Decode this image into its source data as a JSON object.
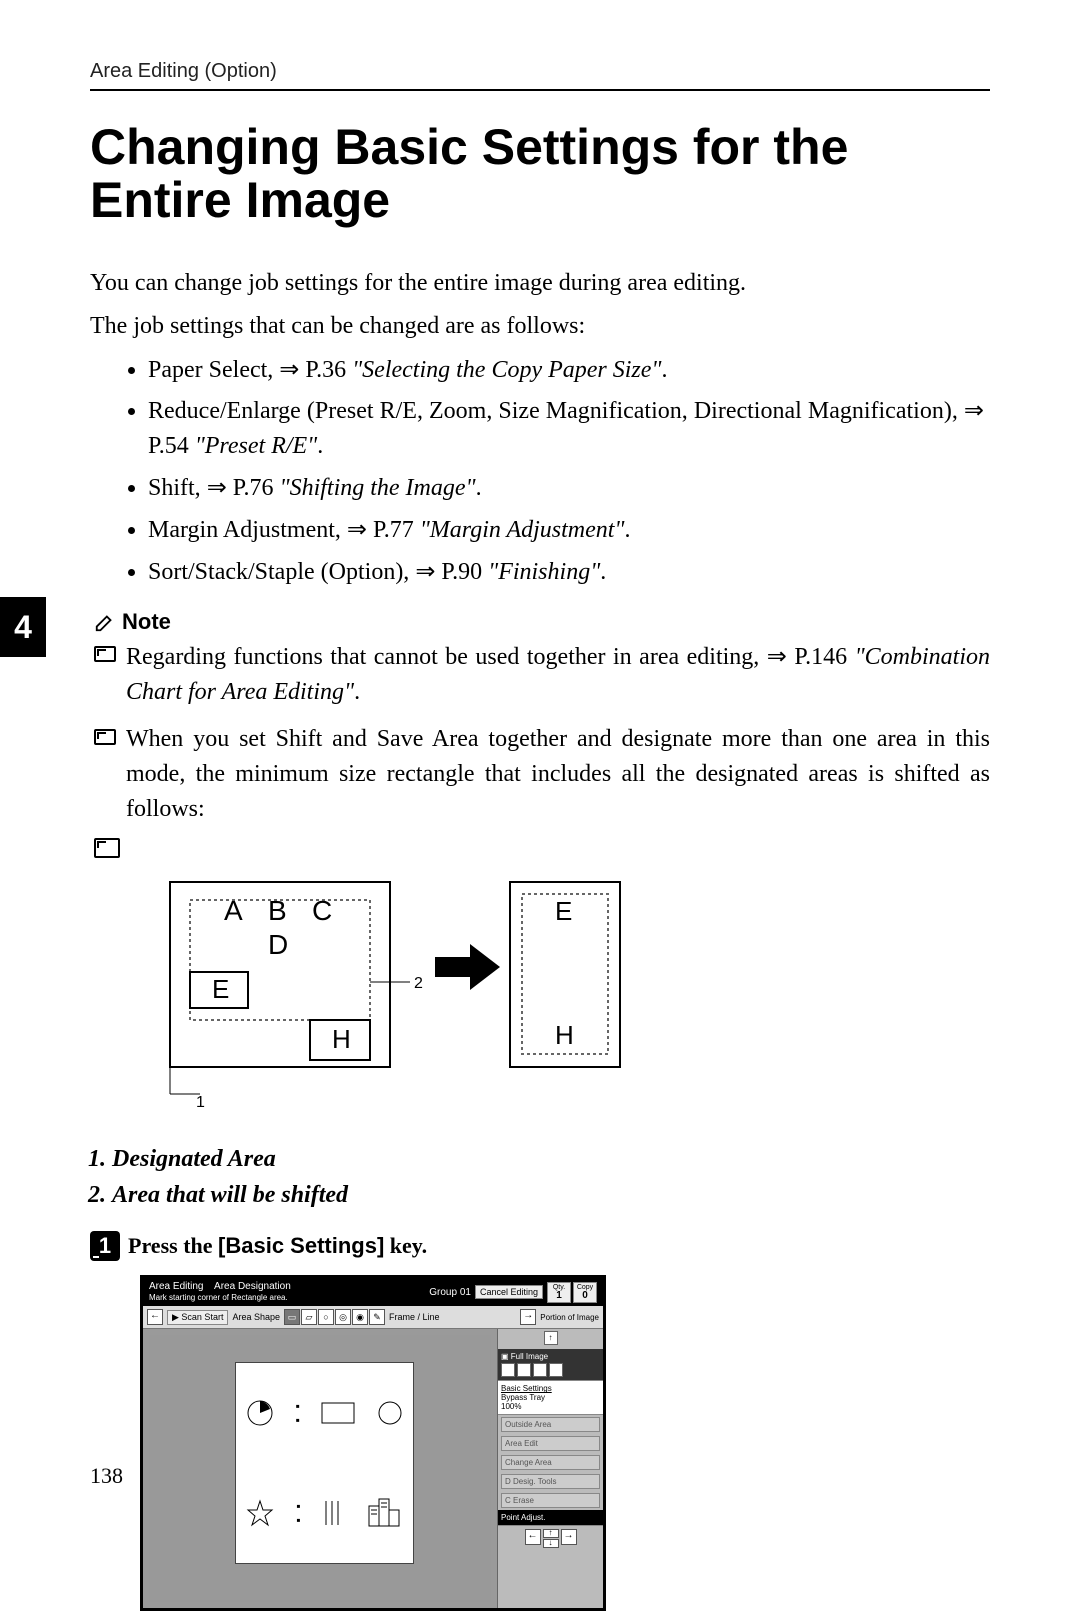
{
  "runningHead": "Area Editing (Option)",
  "title": "Changing Basic Settings for the Entire Image",
  "intro1": "You can change job settings for the entire image during area editing.",
  "intro2": "The job settings that can be changed are as follows:",
  "bullets": {
    "b1a": "Paper Select, ",
    "b1b": " P.36 ",
    "b1c": "\"Selecting the Copy Paper Size\"",
    "b1d": ".",
    "b2a": "Reduce/Enlarge (Preset R/E, Zoom, Size Magnification, Directional Magnification), ",
    "b2b": " P.54 ",
    "b2c": "\"Preset R/E\"",
    "b2d": ".",
    "b3a": "Shift, ",
    "b3b": " P.76 ",
    "b3c": "\"Shifting the Image\"",
    "b3d": ".",
    "b4a": "Margin Adjustment, ",
    "b4b": " P.77 ",
    "b4c": "\"Margin Adjustment\"",
    "b4d": ".",
    "b5a": "Sort/Stack/Staple (Option), ",
    "b5b": " P.90 ",
    "b5c": "\"Finishing\"",
    "b5d": "."
  },
  "sideTab": "4",
  "noteHead": "Note",
  "notes": {
    "n1a": "Regarding functions that cannot be used together in area editing, ",
    "n1b": " P.146 ",
    "n1c": "\"Combination Chart for Area Editing\"",
    "n1d": ".",
    "n2": "When you set Shift and Save Area together and designate more than one area in this mode, the minimum size rectangle that includes all the designated areas is shifted as follows:"
  },
  "diag": {
    "A": "A",
    "B": "B",
    "C": "C",
    "D": "D",
    "E": "E",
    "H": "H",
    "one": "1",
    "two": "2"
  },
  "captions": {
    "c1": "Designated Area",
    "c2": "Area that will be shifted"
  },
  "step1": {
    "badge": "1",
    "a": "Press the ",
    "b": "[Basic Settings]",
    "c": " key."
  },
  "ss": {
    "topL1": "Area Editing",
    "topL2": "Area Designation",
    "topL3": "Mark starting corner of Rectangle area.",
    "group": "Group 01",
    "cancel": "Cancel Editing",
    "qtyL": "Qty.",
    "qty1": "1",
    "copyL": "Copy",
    "copy0": "0",
    "scan": "Scan Start",
    "shape": "Area Shape",
    "frame": "Frame / Line",
    "portion": "Portion of Image",
    "full": "Full Image",
    "basic": "Basic Settings",
    "bypass1": "Bypass Tray",
    "bypass2": "100%",
    "ob": "Outside Area",
    "ae": "Area Edit",
    "cs": "Change Area",
    "dt": "Desig. Tools",
    "er": "Erase",
    "cletter": "C",
    "dletter": "D",
    "pa": "Point Adjust."
  },
  "pageNum": "138"
}
